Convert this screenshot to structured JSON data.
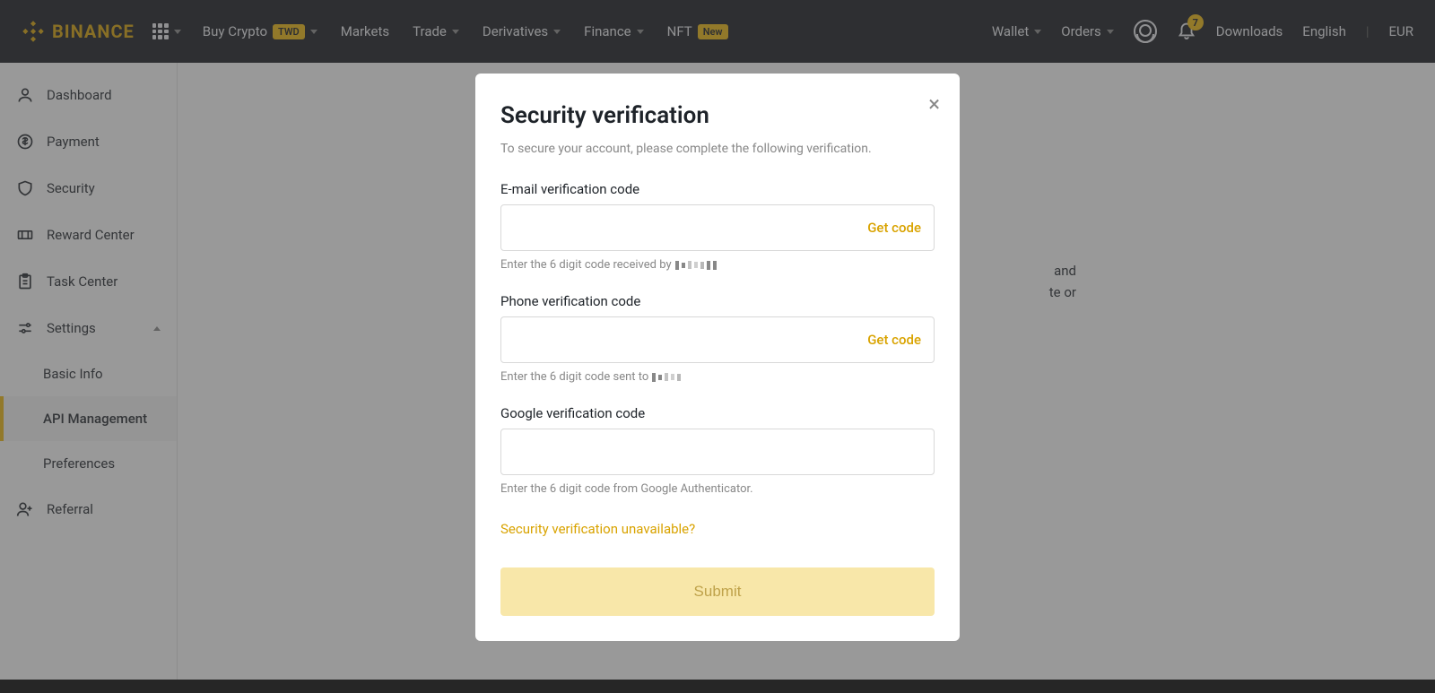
{
  "header": {
    "brand": "BINANCE",
    "buy_crypto": "Buy Crypto",
    "buy_crypto_badge": "TWD",
    "markets": "Markets",
    "trade": "Trade",
    "derivatives": "Derivatives",
    "finance": "Finance",
    "nft": "NFT",
    "nft_badge": "New",
    "wallet": "Wallet",
    "orders": "Orders",
    "notif_count": "7",
    "downloads": "Downloads",
    "english": "English",
    "currency": "EUR"
  },
  "sidebar": {
    "dashboard": "Dashboard",
    "payment": "Payment",
    "security": "Security",
    "reward_center": "Reward Center",
    "task_center": "Task Center",
    "settings": "Settings",
    "basic_info": "Basic Info",
    "api_management": "API Management",
    "preferences": "Preferences",
    "referral": "Referral"
  },
  "background": {
    "line1": "and",
    "line2": "te or"
  },
  "modal": {
    "title": "Security verification",
    "subtitle": "To secure your account, please complete the following verification.",
    "email_label": "E-mail verification code",
    "email_hint_prefix": "Enter the 6 digit code received by",
    "phone_label": "Phone verification code",
    "phone_hint_prefix": "Enter the 6 digit code sent to",
    "google_label": "Google verification code",
    "google_hint": "Enter the 6 digit code from Google Authenticator.",
    "get_code": "Get code",
    "help_link": "Security verification unavailable?",
    "submit": "Submit"
  }
}
